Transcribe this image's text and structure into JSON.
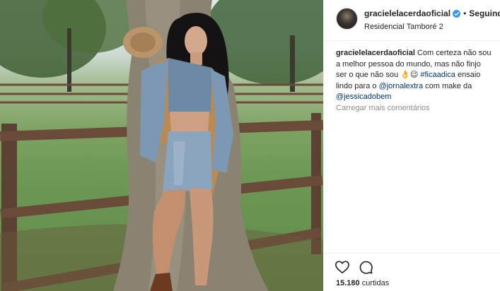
{
  "post": {
    "username": "gracielelacerdaoficial",
    "separator": "•",
    "follow_status": "Seguindo",
    "location": "Residencial Tamboré 2",
    "caption": {
      "username": "gracielelacerdaoficial",
      "text1": "Com certeza não sou a melhor pessoa do mundo, mas não finjo ser o que não sou 👌😉",
      "hashtag": "#ficaadica",
      "text2": "ensaio lindo para o",
      "mention1": "@jornalextra",
      "text3": "com make da",
      "mention2": "@jessicadobem"
    },
    "load_more": "Carregar mais comentários",
    "likes_count": "15.180",
    "likes_label": "curtidas"
  },
  "icons": {
    "verified": "verified-badge-icon",
    "like": "heart-icon",
    "comment": "comment-icon"
  },
  "colors": {
    "verified": "#3897f0",
    "link": "#003569",
    "muted": "#8e8e8e"
  }
}
